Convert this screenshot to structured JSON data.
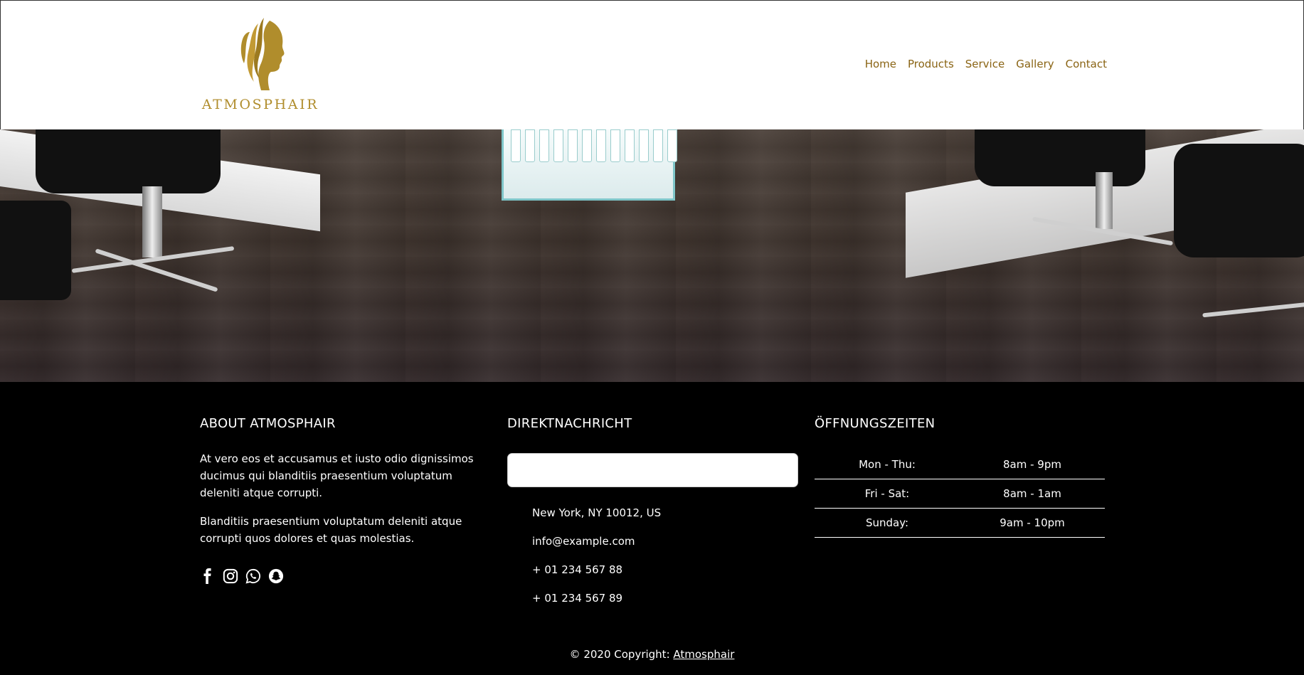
{
  "brand": {
    "name": "ATMOSPHAIR",
    "color": "#b08d2c"
  },
  "nav": {
    "color": "#8a6414",
    "items": [
      {
        "label": "Home"
      },
      {
        "label": "Products"
      },
      {
        "label": "Service"
      },
      {
        "label": "Gallery"
      },
      {
        "label": "Contact"
      }
    ]
  },
  "hero": {
    "description_icon": "salon-interior-photo"
  },
  "footer": {
    "about": {
      "title": "ABOUT ATMOSPHAIR",
      "paragraphs": [
        "At vero eos et accusamus et iusto odio dignissimos ducimus qui blanditiis praesentium voluptatum deleniti atque corrupti.",
        "Blanditiis praesentium voluptatum deleniti atque corrupti quos dolores et quas molestias."
      ],
      "social_icons": [
        "facebook-icon",
        "instagram-icon",
        "whatsapp-icon",
        "snapchat-icon"
      ]
    },
    "direct": {
      "title": "DIREKTNACHRICHT",
      "input_value": "",
      "contacts": [
        "New York, NY 10012, US",
        "info@example.com",
        "+ 01 234 567 88",
        "+ 01 234 567 89"
      ]
    },
    "hours": {
      "title": "ÖFFNUNGSZEITEN",
      "rows": [
        {
          "day": "Mon - Thu:",
          "time": "8am - 9pm"
        },
        {
          "day": "Fri - Sat:",
          "time": "8am - 1am"
        },
        {
          "day": "Sunday:",
          "time": "9am - 10pm"
        }
      ]
    },
    "copyright": {
      "prefix": "© 2020 Copyright: ",
      "link": "Atmosphair"
    }
  }
}
